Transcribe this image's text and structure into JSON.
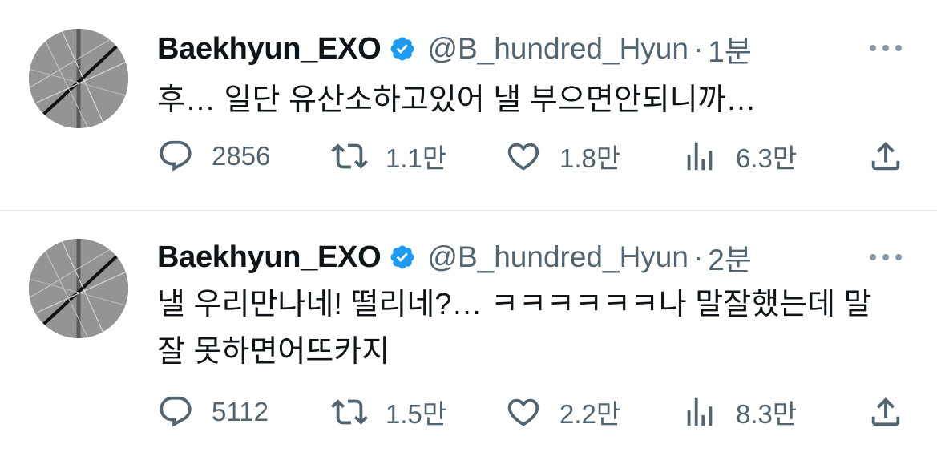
{
  "tweets": [
    {
      "display_name": "Baekhyun_EXO",
      "handle": "@B_hundred_Hyun",
      "separator": "·",
      "time": "1분",
      "text": "후… 일단 유산소하고있어 낼 부으면안되니까…",
      "replies": "2856",
      "retweets": "1.1만",
      "likes": "1.8만",
      "views": "6.3만"
    },
    {
      "display_name": "Baekhyun_EXO",
      "handle": "@B_hundred_Hyun",
      "separator": "·",
      "time": "2분",
      "text": "낼 우리만나네! 떨리네?… ㅋㅋㅋㅋㅋㅋ나 말잘했는데 말 잘 못하면어뜨카지",
      "replies": "5112",
      "retweets": "1.5만",
      "likes": "2.2만",
      "views": "8.3만"
    }
  ],
  "icons": {
    "verified": "verified-badge-icon",
    "more": "more-horizontal-icon",
    "reply": "reply-bubble-icon",
    "retweet": "retweet-icon",
    "like": "heart-icon",
    "views": "views-bar-chart-icon",
    "share": "share-upload-icon"
  },
  "colors": {
    "verified_blue": "#1d9bf0",
    "secondary_text": "#536471",
    "primary_text": "#0f1419",
    "divider": "#e6e9eb"
  }
}
